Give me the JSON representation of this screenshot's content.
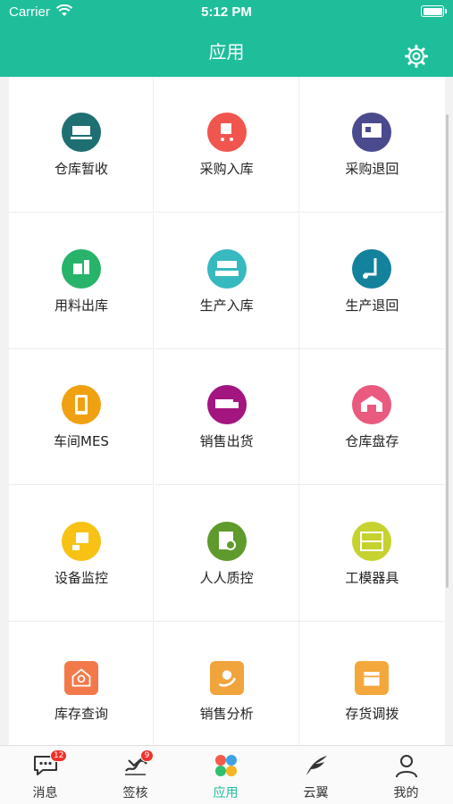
{
  "status_bar": {
    "carrier": "Carrier",
    "time": "5:12 PM"
  },
  "header": {
    "title": "应用",
    "settings_icon": "gear-icon"
  },
  "apps": [
    {
      "label": "仓库暂收",
      "icon": "warehouse-receipt-icon",
      "color": "#1e6f72"
    },
    {
      "label": "采购入库",
      "icon": "purchase-inbound-icon",
      "color": "#f0554e"
    },
    {
      "label": "采购退回",
      "icon": "purchase-return-icon",
      "color": "#4a4a8e"
    },
    {
      "label": "用料出库",
      "icon": "material-outbound-icon",
      "color": "#27b36a"
    },
    {
      "label": "生产入库",
      "icon": "production-inbound-icon",
      "color": "#37b9c0"
    },
    {
      "label": "生产退回",
      "icon": "production-return-icon",
      "color": "#13829c"
    },
    {
      "label": "车间MES",
      "icon": "workshop-mes-icon",
      "color": "#f0a111"
    },
    {
      "label": "销售出货",
      "icon": "sales-shipment-icon",
      "color": "#a3157f"
    },
    {
      "label": "仓库盘存",
      "icon": "warehouse-inventory-icon",
      "color": "#ea5a7e"
    },
    {
      "label": "设备监控",
      "icon": "equipment-monitor-icon",
      "color": "#f7c214"
    },
    {
      "label": "人人质控",
      "icon": "quality-control-icon",
      "color": "#5e9a2c"
    },
    {
      "label": "工模器具",
      "icon": "tooling-icon",
      "color": "#c6d22e"
    },
    {
      "label": "库存查询",
      "icon": "stock-query-icon",
      "color": "#f27a4a"
    },
    {
      "label": "销售分析",
      "icon": "sales-analysis-icon",
      "color": "#f0a43b"
    },
    {
      "label": "存货调拨",
      "icon": "inventory-transfer-icon",
      "color": "#f4a73b"
    }
  ],
  "tabs": [
    {
      "label": "消息",
      "icon": "message-icon",
      "badge": "12"
    },
    {
      "label": "签核",
      "icon": "sign-approve-icon",
      "badge": "9"
    },
    {
      "label": "应用",
      "icon": "apps-icon",
      "active": true
    },
    {
      "label": "云翼",
      "icon": "cloud-wing-icon"
    },
    {
      "label": "我的",
      "icon": "profile-icon"
    }
  ],
  "colors": {
    "brand": "#1fbe9b",
    "badge": "#f0302a"
  }
}
